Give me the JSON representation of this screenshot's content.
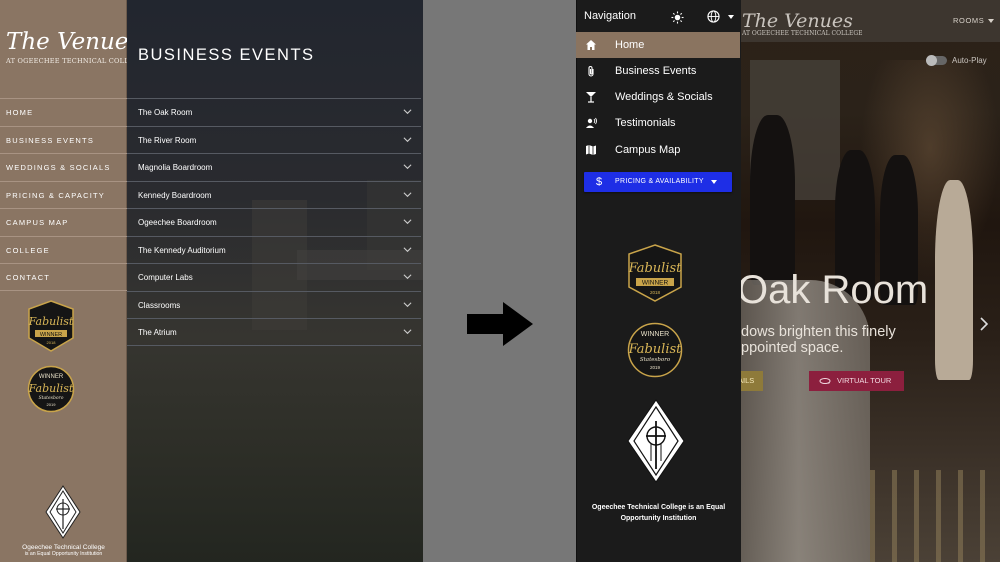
{
  "left": {
    "brand": {
      "script": "The Venues",
      "sub": "AT OGEECHEE TECHNICAL COLLEGE"
    },
    "nav": [
      "HOME",
      "BUSINESS EVENTS",
      "WEDDINGS & SOCIALS",
      "PRICING & CAPACITY",
      "CAMPUS MAP",
      "COLLEGE",
      "CONTACT"
    ],
    "page_title": "BUSINESS EVENTS",
    "rooms": [
      "The Oak Room",
      "The River Room",
      "Magnolia Boardroom",
      "Kennedy Boardroom",
      "Ogeechee Boardroom",
      "The Kennedy Auditorium",
      "Computer Labs",
      "Classrooms",
      "The Atrium"
    ],
    "badges": {
      "fabulist_1": "Fabulist",
      "winner_1": "WINNER",
      "year_1": "2018",
      "winner_2": "WINNER",
      "fabulist_2": "Fabulist",
      "place_2": "Statesboro",
      "year_2": "2019"
    },
    "footer": {
      "line1": "Ogeechee Technical College",
      "line2": "is an Equal Opportunity Institution"
    }
  },
  "right": {
    "brand": {
      "script": "The Venues",
      "sub": "AT OGEECHEE TECHNICAL COLLEGE"
    },
    "rooms_menu": "ROOMS",
    "autoplay": "Auto-Play",
    "hero": {
      "title": "Oak Room",
      "sub1": "dows brighten this finely",
      "sub2": "ppointed space.",
      "details": "AILS",
      "tour": "VIRTUAL TOUR"
    },
    "drawer": {
      "title": "Navigation",
      "items": [
        {
          "label": "Home",
          "icon": "home-icon"
        },
        {
          "label": "Business Events",
          "icon": "paperclip-icon"
        },
        {
          "label": "Weddings & Socials",
          "icon": "cocktail-icon"
        },
        {
          "label": "Testimonials",
          "icon": "person-voice-icon"
        },
        {
          "label": "Campus Map",
          "icon": "map-icon"
        }
      ],
      "pricing": "PRICING & AVAILABILITY",
      "badges": {
        "fabulist_1": "Fabulist",
        "winner_1": "WINNER",
        "year_1": "2018",
        "winner_2": "WINNER",
        "fabulist_2": "Fabulist",
        "place_2": "Statesboro",
        "year_2": "2019"
      },
      "footer": {
        "line1": "Ogeechee Technical College is an Equal",
        "line2": "Opportunity Institution"
      }
    }
  },
  "colors": {
    "sidebar_brown": "#8a7563",
    "active_brown": "#8a7460",
    "pricing_blue": "#1e2ee6",
    "tour_red": "#8c1f3e",
    "drawer_bg": "#1b1b1b"
  }
}
